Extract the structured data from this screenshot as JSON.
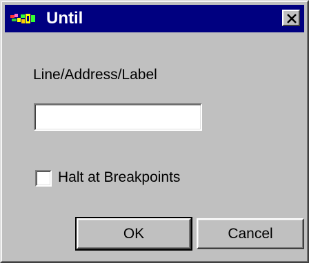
{
  "window": {
    "title": "Until"
  },
  "form": {
    "field_label": "Line/Address/Label",
    "field_value": "",
    "field_placeholder": "",
    "checkbox_label": "Halt at Breakpoints",
    "checkbox_checked": false
  },
  "buttons": {
    "ok_label": "OK",
    "cancel_label": "Cancel"
  },
  "icons": {
    "app": "debugger-app-icon",
    "close": "close-icon"
  },
  "colors": {
    "titlebar": "#000080",
    "face": "#c0c0c0"
  }
}
